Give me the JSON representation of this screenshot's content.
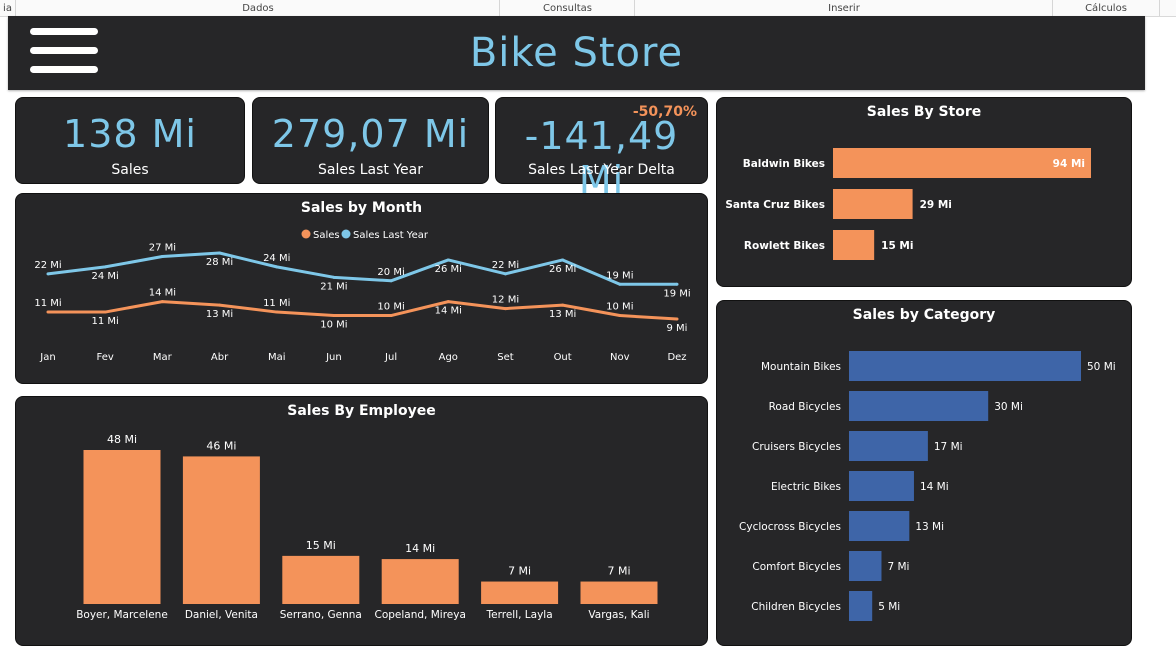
{
  "menu_tabs": [
    "ia",
    "Dados",
    "Consultas",
    "Inserir",
    "Cálculos"
  ],
  "header": {
    "title": "Bike Store"
  },
  "kpis": [
    {
      "value": "138 Mi",
      "label": "Sales"
    },
    {
      "value": "279,07 Mi",
      "label": "Sales Last Year"
    },
    {
      "value": "-141,49 Mi",
      "label": "Sales Last Year Delta",
      "delta": "-50,70%"
    }
  ],
  "colors": {
    "sales": "#f4935a",
    "sales_last_year": "#7ec7e8",
    "category_bar": "#3e65a8",
    "panel": "#262628"
  },
  "chart_data": [
    {
      "id": "sales_by_month",
      "type": "line",
      "title": "Sales by Month",
      "categories": [
        "Jan",
        "Fev",
        "Mar",
        "Abr",
        "Mai",
        "Jun",
        "Jul",
        "Ago",
        "Set",
        "Out",
        "Nov",
        "Dez"
      ],
      "series": [
        {
          "name": "Sales",
          "values": [
            11,
            11,
            14,
            13,
            11,
            10,
            10,
            14,
            12,
            13,
            10,
            9
          ],
          "labels": [
            "11 Mi",
            "11 Mi",
            "14 Mi",
            "13 Mi",
            "11 Mi",
            "10 Mi",
            "10 Mi",
            "14 Mi",
            "12 Mi",
            "13 Mi",
            "10 Mi",
            "9 Mi"
          ]
        },
        {
          "name": "Sales Last Year",
          "values": [
            22,
            24,
            27,
            28,
            24,
            21,
            20,
            26,
            22,
            26,
            19,
            19
          ],
          "labels": [
            "22 Mi",
            "24 Mi",
            "27 Mi",
            "28 Mi",
            "24 Mi",
            "21 Mi",
            "20 Mi",
            "26 Mi",
            "22 Mi",
            "26 Mi",
            "19 Mi",
            "19 Mi"
          ]
        }
      ],
      "legend": "top-center",
      "ylim": [
        0,
        30
      ]
    },
    {
      "id": "sales_by_employee",
      "type": "bar",
      "title": "Sales By Employee",
      "categories": [
        "Boyer, Marcelene",
        "Daniel, Venita",
        "Serrano, Genna",
        "Copeland, Mireya",
        "Terrell, Layla",
        "Vargas, Kali"
      ],
      "values": [
        48,
        46,
        15,
        14,
        7,
        7
      ],
      "labels": [
        "48 Mi",
        "46 Mi",
        "15 Mi",
        "14 Mi",
        "7 Mi",
        "7 Mi"
      ],
      "ylim": [
        0,
        48
      ]
    },
    {
      "id": "sales_by_store",
      "type": "bar",
      "orientation": "horizontal",
      "title": "Sales By Store",
      "categories": [
        "Baldwin Bikes",
        "Santa Cruz Bikes",
        "Rowlett Bikes"
      ],
      "values": [
        94,
        29,
        15
      ],
      "labels": [
        "94 Mi",
        "29 Mi",
        "15 Mi"
      ],
      "xlim": [
        0,
        94
      ]
    },
    {
      "id": "sales_by_category",
      "type": "bar",
      "orientation": "horizontal",
      "title": "Sales by Category",
      "categories": [
        "Mountain Bikes",
        "Road Bicycles",
        "Cruisers Bicycles",
        "Electric Bikes",
        "Cyclocross Bicycles",
        "Comfort Bicycles",
        "Children Bicycles"
      ],
      "values": [
        50,
        30,
        17,
        14,
        13,
        7,
        5
      ],
      "labels": [
        "50 Mi",
        "30 Mi",
        "17 Mi",
        "14 Mi",
        "13 Mi",
        "7 Mi",
        "5 Mi"
      ],
      "xlim": [
        0,
        50
      ]
    }
  ]
}
